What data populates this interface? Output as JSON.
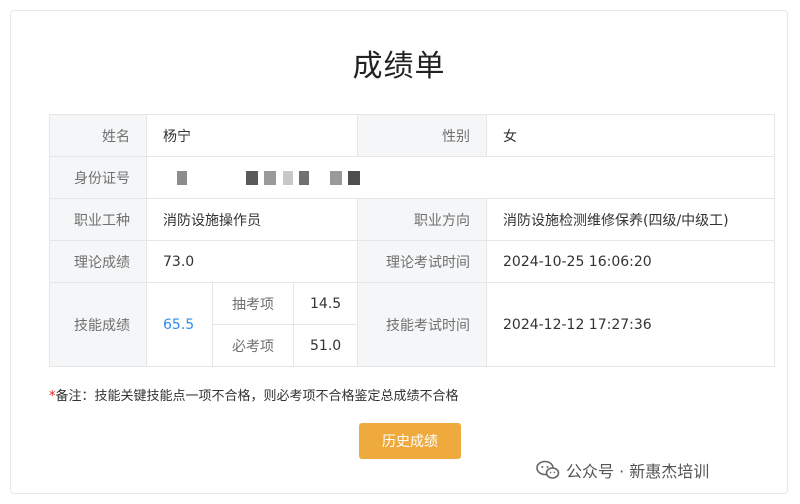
{
  "title": "成绩单",
  "table": {
    "name_label": "姓名",
    "name_value": "杨宁",
    "gender_label": "性别",
    "gender_value": "女",
    "id_label": "身份证号",
    "occupation_label": "职业工种",
    "occupation_value": "消防设施操作员",
    "direction_label": "职业方向",
    "direction_value": "消防设施检测维修保养(四级/中级工)",
    "theory_label": "理论成绩",
    "theory_value": "73.0",
    "theory_time_label": "理论考试时间",
    "theory_time_value": "2024-10-25 16:06:20",
    "skill_label": "技能成绩",
    "skill_value": "65.5",
    "skill_sub1_label": "抽考项",
    "skill_sub1_value": "14.5",
    "skill_sub2_label": "必考项",
    "skill_sub2_value": "51.0",
    "skill_time_label": "技能考试时间",
    "skill_time_value": "2024-12-12 17:27:36"
  },
  "note": {
    "star": "*",
    "text": "备注：技能关键技能点一项不合格，则必考项不合格鉴定总成绩不合格"
  },
  "history_button": "历史成绩",
  "watermark": {
    "icon": "wechat-icon",
    "text": "公众号 · 新惠杰培训"
  },
  "colors": {
    "accent_button": "#eeaa3c",
    "skill_score": "#2d8cf0",
    "label_bg": "#f5f6f7"
  }
}
